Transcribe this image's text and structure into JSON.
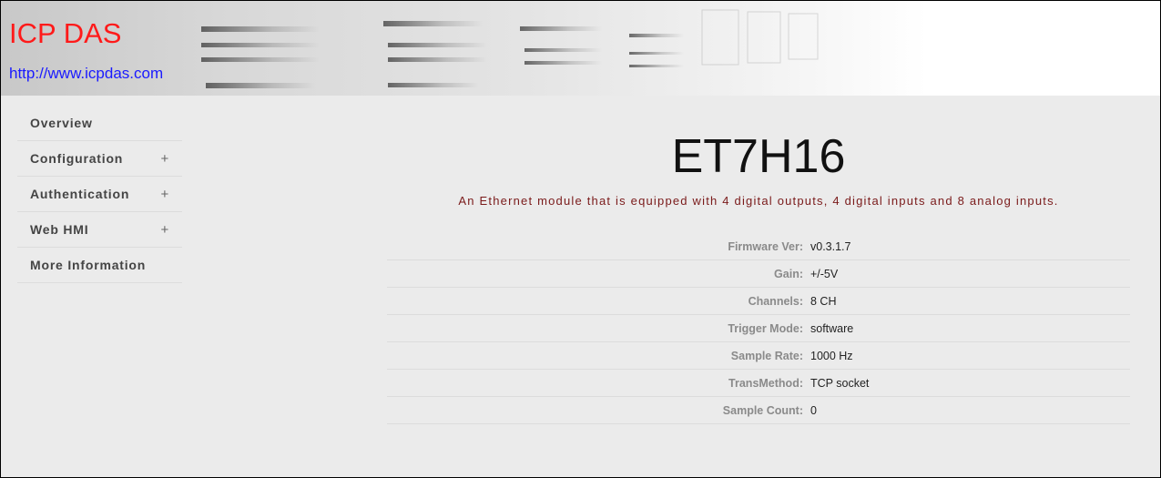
{
  "header": {
    "brand": "ICP DAS",
    "link": "http://www.icpdas.com"
  },
  "sidebar": {
    "items": [
      {
        "label": "Overview",
        "expand": ""
      },
      {
        "label": "Configuration",
        "expand": "+"
      },
      {
        "label": "Authentication",
        "expand": "+"
      },
      {
        "label": "Web HMI",
        "expand": "+"
      },
      {
        "label": "More Information",
        "expand": ""
      }
    ]
  },
  "main": {
    "title": "ET7H16",
    "description": "An Ethernet module that is equipped with 4 digital outputs, 4 digital inputs and 8 analog inputs.",
    "info": [
      {
        "label": "Firmware Ver:",
        "value": "v0.3.1.7"
      },
      {
        "label": "Gain:",
        "value": "+/-5V"
      },
      {
        "label": "Channels:",
        "value": "8 CH"
      },
      {
        "label": "Trigger Mode:",
        "value": "software"
      },
      {
        "label": "Sample Rate:",
        "value": "1000 Hz"
      },
      {
        "label": "TransMethod:",
        "value": "TCP socket"
      },
      {
        "label": "Sample Count:",
        "value": "0"
      }
    ]
  }
}
